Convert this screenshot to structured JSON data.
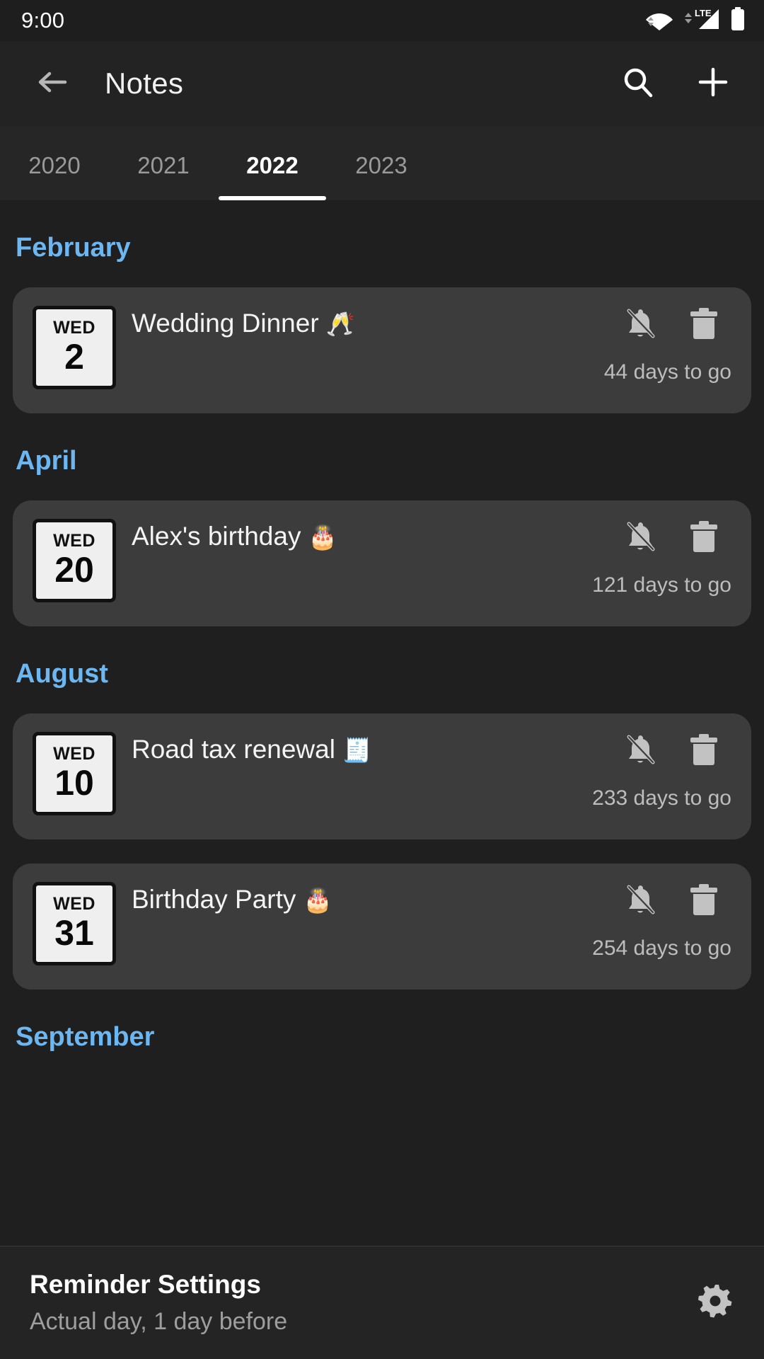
{
  "status_bar": {
    "time": "9:00",
    "network_label": "LTE",
    "icons": [
      "wifi-icon",
      "cellular-signal-icon",
      "battery-icon"
    ]
  },
  "app_bar": {
    "title": "Notes",
    "back_icon": "back-arrow-icon",
    "search_icon": "search-icon",
    "add_icon": "plus-icon"
  },
  "tabs": {
    "items": [
      {
        "label": "2020",
        "active": false
      },
      {
        "label": "2021",
        "active": false
      },
      {
        "label": "2022",
        "active": true
      },
      {
        "label": "2023",
        "active": false
      }
    ],
    "selected": "2022"
  },
  "colors": {
    "month_heading": "#6CB6F2",
    "card_background": "#3c3c3c",
    "page_background": "#1f1f1f",
    "appbar_background": "#232323",
    "tabbar_background": "#262626",
    "icon_gray": "#c2c2c2",
    "countdown_gray": "#bdbdbd"
  },
  "sections": [
    {
      "month": "February",
      "notes": [
        {
          "day_of_week": "WED",
          "day_number": "2",
          "title": "Wedding Dinner",
          "emoji": "🥂",
          "countdown": "44 days to go",
          "mute_icon": "bell-off-icon",
          "delete_icon": "trash-icon"
        }
      ]
    },
    {
      "month": "April",
      "notes": [
        {
          "day_of_week": "WED",
          "day_number": "20",
          "title": "Alex's birthday",
          "emoji": "🎂",
          "countdown": "121 days to go",
          "mute_icon": "bell-off-icon",
          "delete_icon": "trash-icon"
        }
      ]
    },
    {
      "month": "August",
      "notes": [
        {
          "day_of_week": "WED",
          "day_number": "10",
          "title": "Road tax renewal",
          "emoji": "🧾",
          "countdown": "233 days to go",
          "mute_icon": "bell-off-icon",
          "delete_icon": "trash-icon"
        },
        {
          "day_of_week": "WED",
          "day_number": "31",
          "title": "Birthday Party",
          "emoji": "🎂",
          "countdown": "254 days to go",
          "mute_icon": "bell-off-icon",
          "delete_icon": "trash-icon"
        }
      ]
    },
    {
      "month": "September",
      "notes": []
    }
  ],
  "bottom_bar": {
    "title": "Reminder Settings",
    "subtitle": "Actual day, 1 day before",
    "gear_icon": "gear-icon"
  }
}
